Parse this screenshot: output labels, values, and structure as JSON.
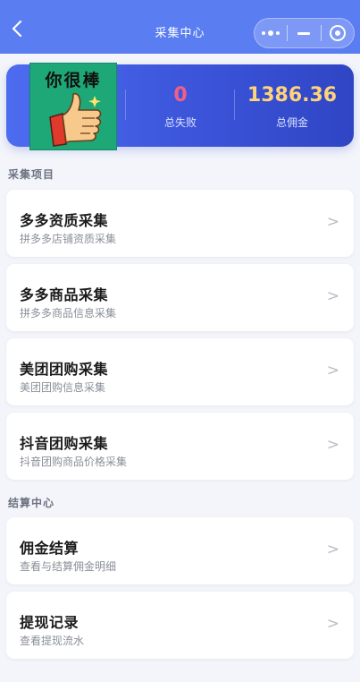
{
  "nav": {
    "title": "采集中心",
    "icons": [
      "back-arrow-icon",
      "more-dots-icon",
      "minimize-icon",
      "close-target-icon"
    ]
  },
  "sticker": {
    "text": "你很棒",
    "image": "thumbs-up-icon"
  },
  "stats": {
    "failed_value": "0",
    "failed_label": "总失败",
    "commission_value": "1386.36",
    "commission_label": "总佣金"
  },
  "sections": [
    {
      "title": "采集项目",
      "items": [
        {
          "title": "多多资质采集",
          "subtitle": "拼多多店铺资质采集",
          "arrow": ">"
        },
        {
          "title": "多多商品采集",
          "subtitle": "拼多多商品信息采集",
          "arrow": ">"
        },
        {
          "title": "美团团购采集",
          "subtitle": "美团团购信息采集",
          "arrow": ">"
        },
        {
          "title": "抖音团购采集",
          "subtitle": "抖音团购商品价格采集",
          "arrow": ">"
        }
      ]
    },
    {
      "title": "结算中心",
      "items": [
        {
          "title": "佣金结算",
          "subtitle": "查看与结算佣金明细",
          "arrow": ">"
        },
        {
          "title": "提现记录",
          "subtitle": "查看提现流水",
          "arrow": ">"
        }
      ]
    }
  ],
  "colors": {
    "nav_bg": "#5a7df2",
    "stats_bg": "#3b54d9",
    "failed_value": "#f25f84",
    "commission_value": "#ffd37a",
    "page_bg": "#f3f5fb"
  }
}
